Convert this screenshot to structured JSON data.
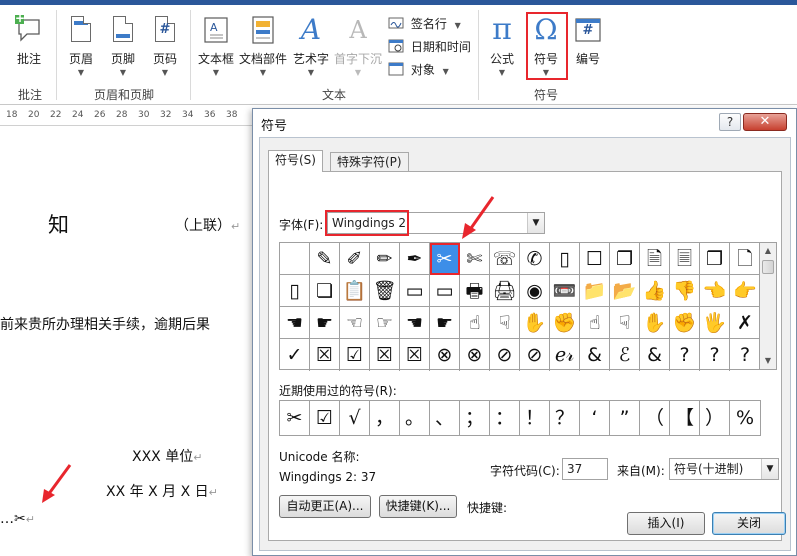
{
  "ribbon": {
    "groups": {
      "annotation": "批注",
      "header_footer": "页眉和页脚",
      "text": "文本",
      "symbols": "符号"
    },
    "buttons": {
      "comment": "批注",
      "header": "页眉",
      "footer": "页脚",
      "page_number": "页码",
      "textbox": "文本框",
      "quick_parts": "文档部件",
      "wordart": "艺术字",
      "dropcap": "首字下沉",
      "signature": "签名行",
      "datetime": "日期和时间",
      "object": "对象",
      "equation": "公式",
      "symbol": "符号",
      "numbering": "编号"
    },
    "glyphs": {
      "equation": "π",
      "symbol": "Ω",
      "page_number": "#",
      "numbering": "#",
      "wordart": "A",
      "dropcap": "A",
      "comment_plus": "+"
    }
  },
  "ruler": {
    "ticks": [
      "18",
      "20",
      "22",
      "24",
      "26",
      "28",
      "30",
      "32",
      "34",
      "36",
      "38"
    ]
  },
  "document": {
    "title_char": "知",
    "copy_label": "（上联）",
    "body_line": "前来贵所办理相关手续，逾期后果",
    "unit": "XXX 单位",
    "date": "XX 年 X 月 X 日",
    "cut_line": "…✂",
    "para_mark": "↵"
  },
  "dialog": {
    "title": "符号",
    "help": "?",
    "close": "✕",
    "tabs": [
      "符号(S)",
      "特殊字符(P)"
    ],
    "font_label": "字体(F):",
    "font_value": "Wingdings 2",
    "grid": [
      [
        "",
        "✎",
        "✐",
        "✏",
        "✒",
        "✂",
        "✄",
        "☏",
        "✆",
        "▯",
        "☐",
        "❐",
        "🗎",
        "🗏",
        "❒",
        "🗋"
      ],
      [
        "▯",
        "❏",
        "📋",
        "🗑",
        "▭",
        "▭",
        "🖶",
        "🖨",
        "◉",
        "📼",
        "📁",
        "📂",
        "👍",
        "👎",
        "👈",
        "👉"
      ],
      [
        "☚",
        "☛",
        "☜",
        "☞",
        "☚",
        "☛",
        "☝",
        "☟",
        "✋",
        "✊",
        "☝",
        "☟",
        "✋",
        "✊",
        "🖐",
        "✗"
      ],
      [
        "✓",
        "☒",
        "☑",
        "☒",
        "☒",
        "⊗",
        "⊗",
        "⊘",
        "⊘",
        "ℯ𝓇",
        "&",
        "ℰ",
        "&",
        "?",
        "?",
        "?"
      ]
    ],
    "recent_label": "近期使用过的符号(R):",
    "recent": [
      "✂",
      "☑",
      "√",
      "，",
      "。",
      "、",
      "；",
      "：",
      "！",
      "？",
      "‘",
      "”",
      "（",
      "【",
      "）",
      "%"
    ],
    "unicode_label": "Unicode 名称:",
    "char_name": "Wingdings 2: 37",
    "char_code_label": "字符代码(C):",
    "char_code": "37",
    "from_label": "来自(M):",
    "from_value": "符号(十进制)",
    "autocorrect": "自动更正(A)...",
    "shortcut_btn": "快捷键(K)...",
    "shortcut_label": "快捷键:",
    "insert": "插入(I)",
    "close_btn": "关闭"
  },
  "colors": {
    "highlight": "#e8262d",
    "accent": "#2b579a",
    "selection": "#3d8ee8"
  }
}
